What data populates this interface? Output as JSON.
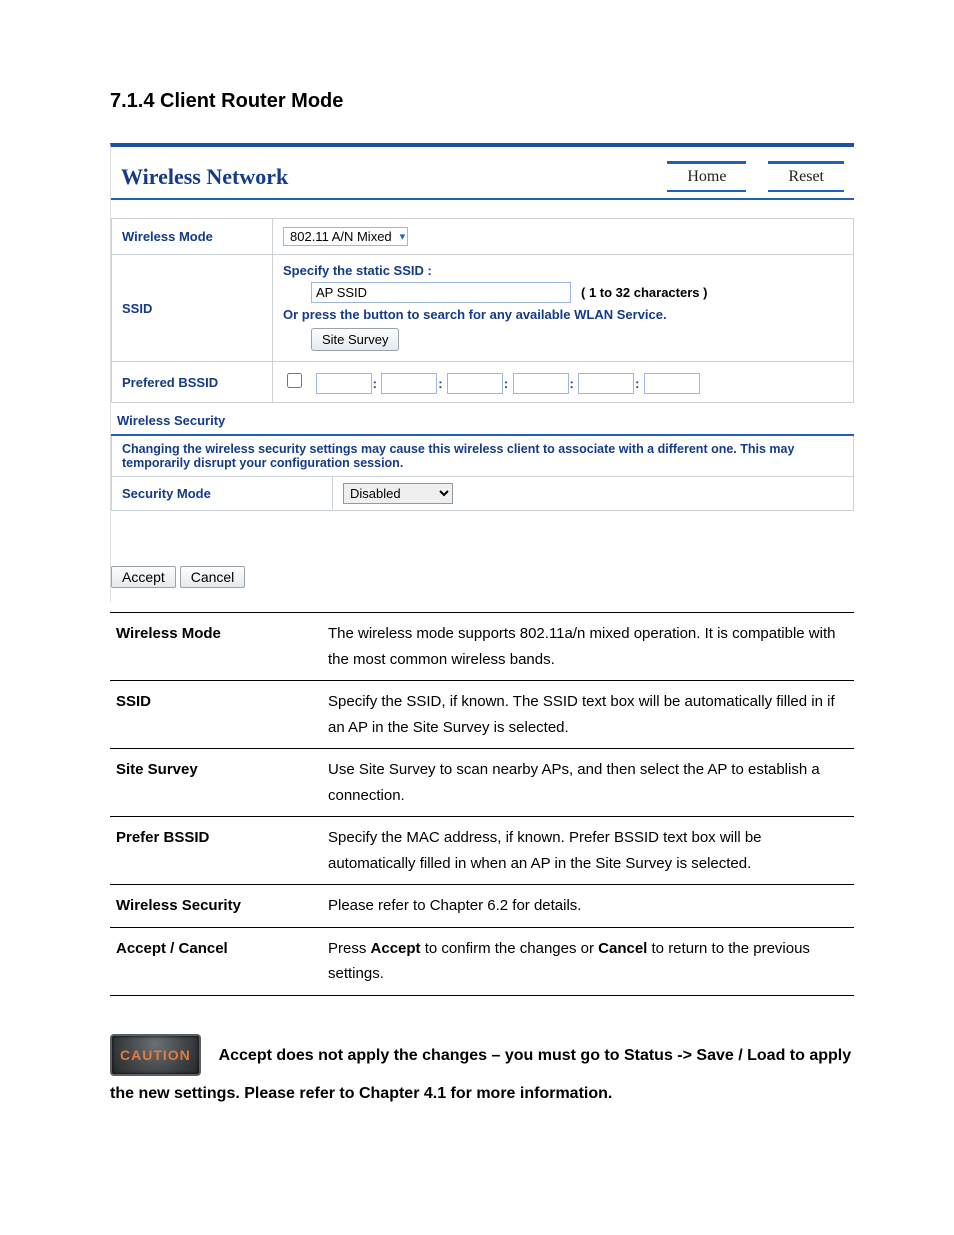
{
  "section_heading": "7.1.4 Client Router Mode",
  "panel": {
    "title": "Wireless Network",
    "links": {
      "home": "Home",
      "reset": "Reset"
    }
  },
  "form": {
    "wireless_mode_label": "Wireless Mode",
    "wireless_mode_value": "802.11 A/N Mixed",
    "ssid_label": "SSID",
    "ssid_line1": "Specify the static SSID  :",
    "ssid_value": "AP SSID",
    "ssid_hint": "( 1 to 32 characters )",
    "ssid_line2": "Or press the button to search for any available WLAN Service.",
    "site_survey_btn": "Site Survey",
    "pref_bssid_label": "Prefered BSSID",
    "sec_subhead": "Wireless Security",
    "sec_warning": "Changing the wireless security settings may cause this wireless client to associate with a different one. This may temporarily disrupt your configuration session.",
    "sec_mode_label": "Security Mode",
    "sec_mode_value": "Disabled",
    "accept_btn": "Accept",
    "cancel_btn": "Cancel"
  },
  "desc": [
    {
      "k": "Wireless Mode",
      "v": "The wireless mode supports 802.11a/n mixed operation. It is compatible with the most common wireless bands."
    },
    {
      "k": "SSID",
      "v": "Specify the SSID, if known. The SSID text box will be automatically filled in if an AP in the Site Survey is selected."
    },
    {
      "k": "Site Survey",
      "v": "Use Site Survey to scan nearby APs, and then select the AP to establish a connection."
    },
    {
      "k": "Prefer BSSID",
      "v": "Specify the MAC address, if known. Prefer BSSID text box will be automatically filled in when an AP in the Site Survey is selected."
    },
    {
      "k": "Wireless Security",
      "v": "Please refer to Chapter 6.2 for details."
    }
  ],
  "desc_accept": {
    "k": "Accept / Cancel",
    "pre": "Press ",
    "b1": "Accept",
    "mid": " to confirm the changes or ",
    "b2": "Cancel",
    "post": " to return to the previous settings."
  },
  "caution": {
    "badge": "CAUTION",
    "text_a": "Accept does not apply the changes – you must go to Status -> Save / Load to apply the new settings. Please refer to Chapter 4.1 for more information."
  }
}
